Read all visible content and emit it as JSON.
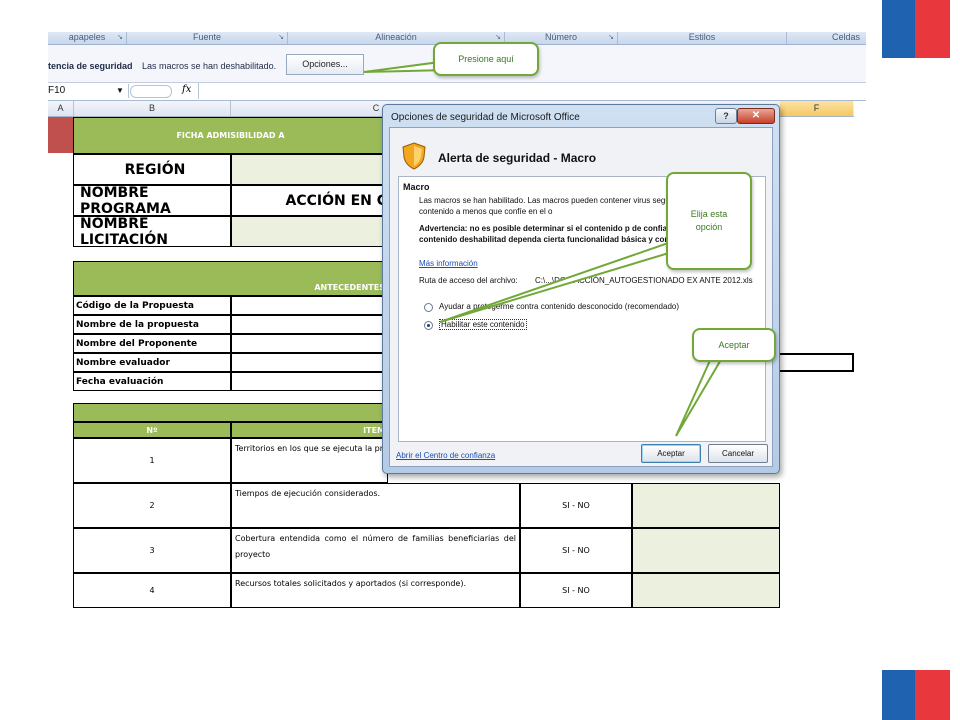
{
  "ribbon": {
    "groups": [
      "apapeles",
      "Fuente",
      "Alineación",
      "Número",
      "Estilos",
      "Celdas"
    ]
  },
  "message_bar": {
    "title": "tencia de seguridad",
    "text": "Las macros se han deshabilitado.",
    "options_button": "Opciones..."
  },
  "formula_bar": {
    "name_box": "F10",
    "fx": "fx"
  },
  "columns": [
    "A",
    "B",
    "C",
    "F"
  ],
  "sheet": {
    "header_title": "FICHA ADMISIBILIDAD A",
    "region_label": "REGIÓN",
    "programa_label": "NOMBRE PROGRAMA",
    "programa_value": "ACCIÓN EN C",
    "licitacion_label": "NOMBRE LICITACIÓN",
    "antecedentes_title": "ANTECEDENTES",
    "fields": [
      "Código de la Propuesta",
      "Nombre de la propuesta",
      "Nombre del Proponente",
      "Nombre evaluador",
      "Fecha evaluación"
    ],
    "table_header_num": "Nº",
    "table_header_item": "ITEM",
    "rows": [
      {
        "num": "1",
        "item": "Territorios en los que se ejecuta la pr",
        "answer": ""
      },
      {
        "num": "2",
        "item": "Tiempos de ejecución considerados.",
        "answer": "SI - NO"
      },
      {
        "num": "3",
        "item": "Cobertura entendida como el número de familias beneficiarias del proyecto",
        "answer": "SI - NO"
      },
      {
        "num": "4",
        "item": "Recursos totales solicitados y aportados (si corresponde).",
        "answer": "SI - NO"
      }
    ]
  },
  "dialog": {
    "title": "Opciones de seguridad de Microsoft Office",
    "help": "?",
    "close": "✕",
    "header": "Alerta de seguridad - Macro",
    "section": "Macro",
    "para1": "Las macros se han habilitado. Las macros pueden contener virus seguridad. No habilite este contenido a menos que confíe en el o",
    "para2": "Advertencia: no es posible determinar si el contenido p de confianza. Debe dejar este contenido deshabilitad dependa cierta funcionalidad básica y confíe en su orig",
    "more_info": "Más información",
    "path_label": "Ruta de acceso del archivo:",
    "path_value": "C:\\...\\DOS\\ACCIÓN_AUTOGESTIONADO EX ANTE 2012.xls",
    "option1": "Ayudar a protegerme contra contenido desconocido (recomendado)",
    "option2": "Habilitar este contenido",
    "trust_center_link": "Abrir el Centro de confianza",
    "accept_button": "Aceptar",
    "cancel_button": "Cancelar"
  },
  "callouts": {
    "press_here": "Presione aquí",
    "choose_option": "Elija esta opción",
    "accept": "Aceptar"
  },
  "colors": {
    "header_green": "#9bbb59",
    "light_green": "#ebf1de",
    "callout_border": "#72a838",
    "flag_blue": "#1f62b0",
    "flag_red": "#e8383d"
  }
}
